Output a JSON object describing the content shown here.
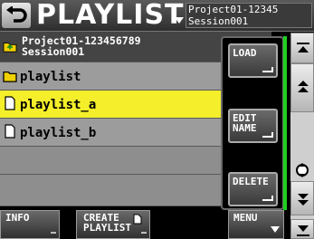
{
  "header": {
    "title": "PLAYLIST",
    "project": "Project01-12345",
    "session": "Session001"
  },
  "list": {
    "parent": {
      "line1": "Project01-123456789",
      "line2": "Session001"
    },
    "items": [
      {
        "label": "playlist",
        "type": "folder"
      },
      {
        "label": "playlist_a",
        "type": "document",
        "selected": true
      },
      {
        "label": "playlist_b",
        "type": "document"
      }
    ]
  },
  "popup": {
    "load": "LOAD",
    "edit_name_1": "EDIT",
    "edit_name_2": "NAME",
    "delete": "DELETE"
  },
  "footer": {
    "info": "INFO",
    "create_1": "CREATE",
    "create_2": "PLAYLIST",
    "menu": "MENU"
  },
  "colors": {
    "selected_row": "#f4ef2a",
    "accent_green": "#20d020",
    "folder_yellow": "#f0d000"
  },
  "icons": [
    "back-arrow-icon",
    "folder-up-icon",
    "folder-icon",
    "document-icon",
    "scroll-top-icon",
    "scroll-up-icon",
    "scroll-thumb-icon",
    "scroll-down-icon",
    "scroll-bottom-icon",
    "new-document-icon"
  ]
}
